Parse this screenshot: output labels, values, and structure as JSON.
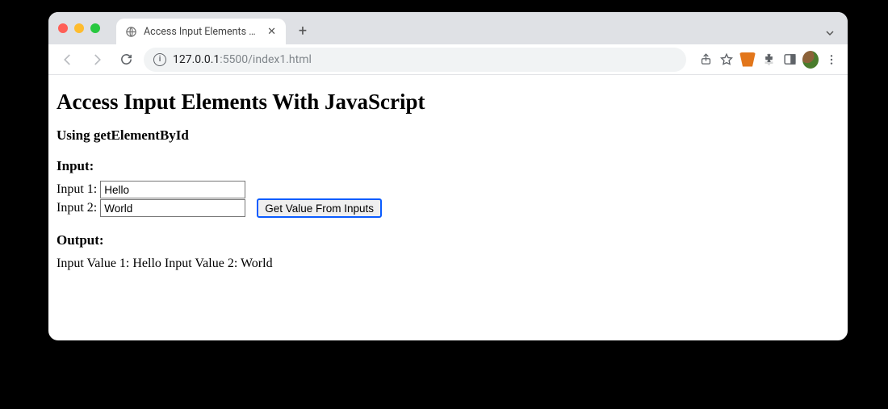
{
  "tab": {
    "title": "Access Input Elements With JavaScript"
  },
  "address": {
    "host": "127.0.0.1",
    "path": ":5500/index1.html"
  },
  "page": {
    "heading": "Access Input Elements With JavaScript",
    "subheading": "Using getElementById",
    "input_section": "Input:",
    "label1": "Input 1:",
    "value1": "Hello",
    "label2": "Input 2:",
    "value2": "World",
    "button": "Get Value From Inputs",
    "output_section": "Output:",
    "output_text": "Input Value 1: Hello Input Value 2: World"
  }
}
